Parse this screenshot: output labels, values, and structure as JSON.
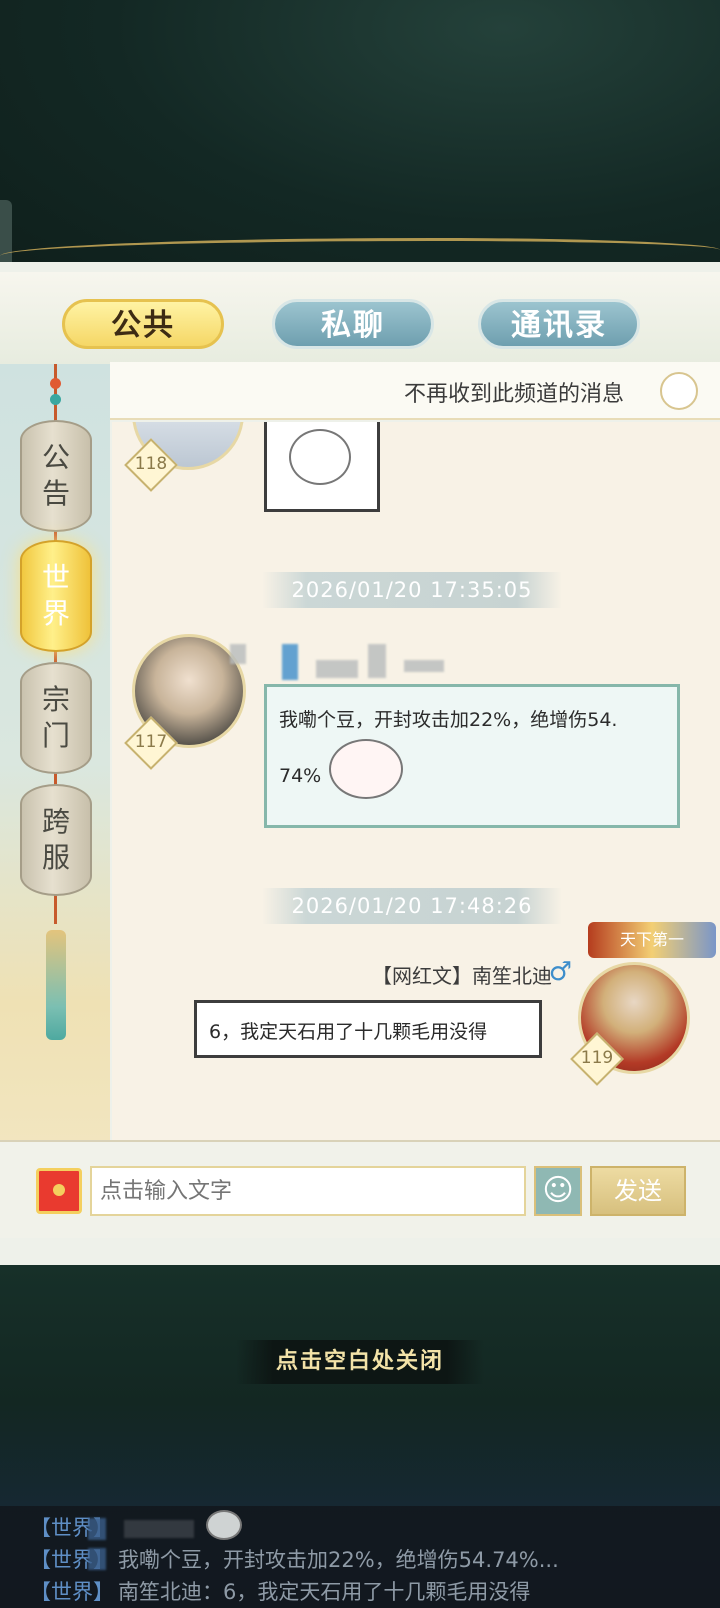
{
  "tabs": {
    "public": "公共",
    "private": "私聊",
    "contacts": "通讯录"
  },
  "sidebar": {
    "items": [
      {
        "label": "公告",
        "chars": [
          "公",
          "告"
        ],
        "active": false
      },
      {
        "label": "世界",
        "chars": [
          "世",
          "界"
        ],
        "active": true
      },
      {
        "label": "宗门",
        "chars": [
          "宗",
          "门"
        ],
        "active": false
      },
      {
        "label": "跨服",
        "chars": [
          "跨",
          "服"
        ],
        "active": false
      }
    ]
  },
  "notice": {
    "text": "不再收到此频道的消息"
  },
  "chat": {
    "messages": [
      {
        "level": "118",
        "sticker": "sweating-bun-sticker"
      },
      {
        "timestamp": "2026/01/20  17:35:05"
      },
      {
        "level": "117",
        "text_line1": "我嘞个豆，开封攻击加22%，绝增伤54.",
        "text_line2": "74%",
        "sticker": "blushing-bun-sticker"
      },
      {
        "timestamp": "2026/01/20  17:48:26"
      },
      {
        "level": "119",
        "guild": "【网红文】",
        "sender": "南笙北迪",
        "gender_icon": "male-icon",
        "title": "天下第一",
        "text": "6，我定天石用了十几颗毛用没得"
      }
    ]
  },
  "input": {
    "placeholder": "点击输入文字",
    "send": "发送",
    "emoji_icon": "smiley-icon",
    "redpacket_icon": "red-packet-icon"
  },
  "close_hint": "点击空白处关闭",
  "feed": [
    {
      "tag": "【世界】",
      "text": ""
    },
    {
      "tag": "【世界】",
      "text": "我嘞个豆，开封攻击加22%，绝增伤54.74%..."
    },
    {
      "tag": "【世界】",
      "text": "南笙北迪：6，我定天石用了十几颗毛用没得"
    }
  ],
  "colors": {
    "active_tab": "#f5d766",
    "inactive_tab": "#7fabb8",
    "accent_gold": "#d8b45c",
    "feed_tag": "#5f8fc6"
  }
}
